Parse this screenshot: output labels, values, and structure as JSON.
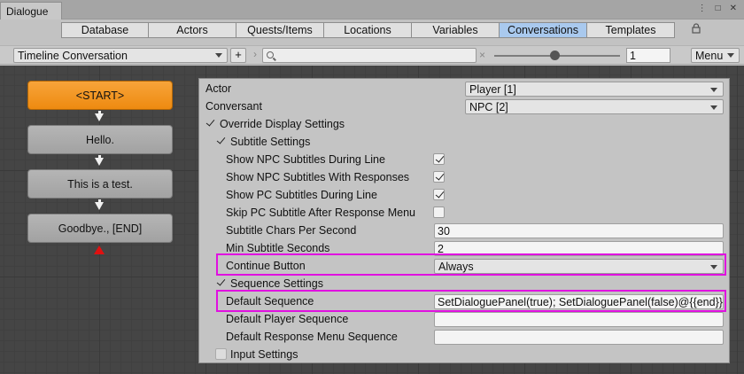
{
  "window": {
    "title": "Dialogue",
    "menu_icon": "kebab-menu-icon",
    "maximize_icon": "maximize-icon",
    "close_icon": "close-icon"
  },
  "tabs": [
    {
      "label": "Database",
      "active": false
    },
    {
      "label": "Actors",
      "active": false
    },
    {
      "label": "Quests/Items",
      "active": false
    },
    {
      "label": "Locations",
      "active": false
    },
    {
      "label": "Variables",
      "active": false
    },
    {
      "label": "Conversations",
      "active": true
    },
    {
      "label": "Templates",
      "active": false
    }
  ],
  "lock_icon": "lock-icon",
  "toolbar": {
    "conversation_select": "Timeline Conversation",
    "add_label": "+",
    "search_value": "",
    "clear_label": "×",
    "zoom_value": "1",
    "menu_label": "Menu"
  },
  "nodes": [
    {
      "label": "<START>",
      "kind": "start"
    },
    {
      "label": "Hello.",
      "kind": "entry"
    },
    {
      "label": "This is a test.",
      "kind": "entry"
    },
    {
      "label": "Goodbye., [END]",
      "kind": "entry"
    }
  ],
  "inspector": {
    "actor": {
      "label": "Actor",
      "value": "Player [1]"
    },
    "conversant": {
      "label": "Conversant",
      "value": "NPC [2]"
    },
    "override_display": {
      "label": "Override Display Settings",
      "checked": true
    },
    "subtitle_settings": {
      "label": "Subtitle Settings",
      "checked": true
    },
    "show_npc_during_line": {
      "label": "Show NPC Subtitles During Line",
      "checked": true
    },
    "show_npc_with_responses": {
      "label": "Show NPC Subtitles With Responses",
      "checked": true
    },
    "show_pc_during_line": {
      "label": "Show PC Subtitles During Line",
      "checked": true
    },
    "skip_pc_after_menu": {
      "label": "Skip PC Subtitle After Response Menu",
      "checked": false
    },
    "chars_per_second": {
      "label": "Subtitle Chars Per Second",
      "value": "30"
    },
    "min_seconds": {
      "label": "Min Subtitle Seconds",
      "value": "2"
    },
    "continue_button": {
      "label": "Continue Button",
      "value": "Always"
    },
    "sequence_settings": {
      "label": "Sequence Settings",
      "checked": true
    },
    "default_sequence": {
      "label": "Default Sequence",
      "value": "SetDialoguePanel(true); SetDialoguePanel(false)@{{end}}"
    },
    "default_player_sequence": {
      "label": "Default Player Sequence",
      "value": ""
    },
    "default_response_menu_sequence": {
      "label": "Default Response Menu Sequence",
      "value": ""
    },
    "input_settings": {
      "label": "Input Settings",
      "checked": false
    }
  },
  "colors": {
    "accent_tab": "#a9c9ee",
    "start_node": "#f29520",
    "highlight": "#e010e0",
    "end_marker": "#e01010"
  }
}
